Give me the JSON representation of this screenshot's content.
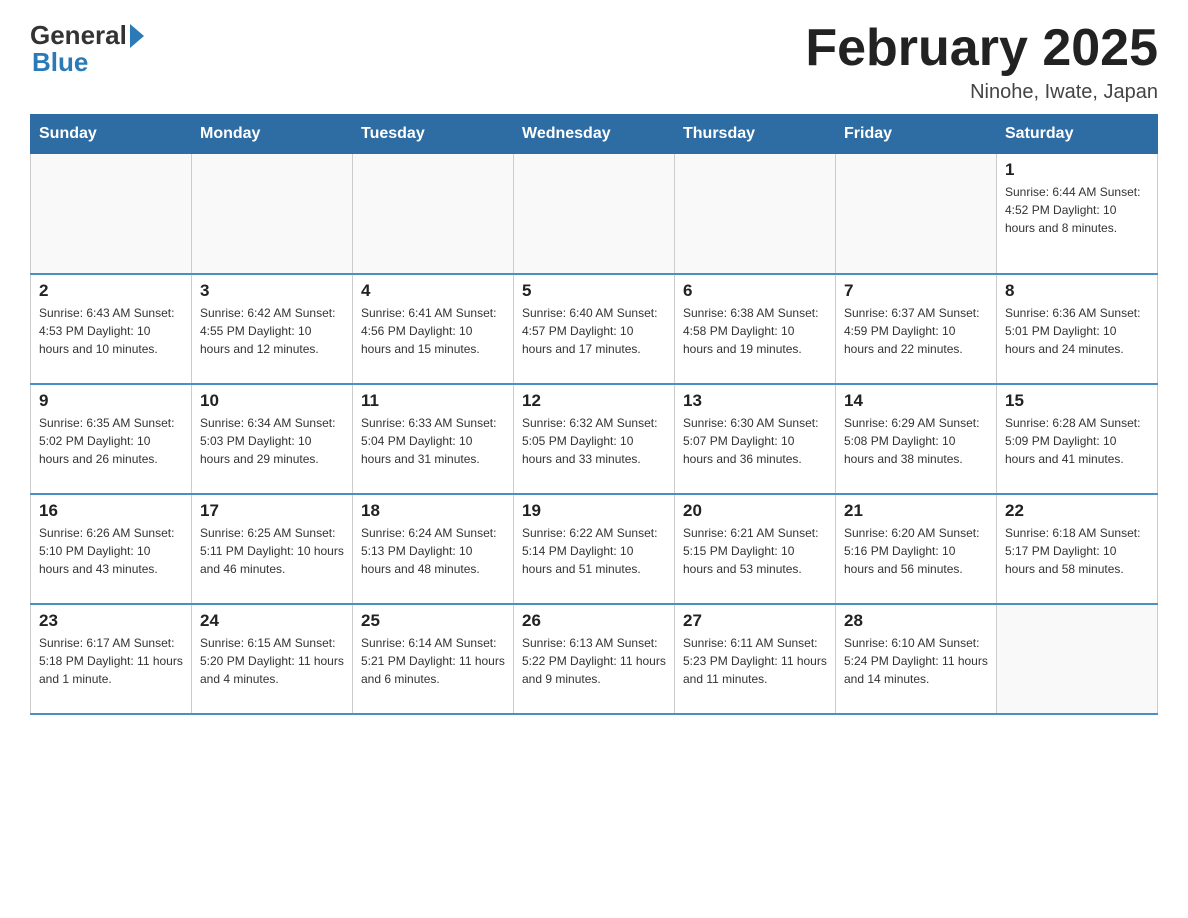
{
  "header": {
    "logo_general": "General",
    "logo_blue": "Blue",
    "month_title": "February 2025",
    "location": "Ninohe, Iwate, Japan"
  },
  "weekdays": [
    "Sunday",
    "Monday",
    "Tuesday",
    "Wednesday",
    "Thursday",
    "Friday",
    "Saturday"
  ],
  "weeks": [
    [
      {
        "day": "",
        "info": ""
      },
      {
        "day": "",
        "info": ""
      },
      {
        "day": "",
        "info": ""
      },
      {
        "day": "",
        "info": ""
      },
      {
        "day": "",
        "info": ""
      },
      {
        "day": "",
        "info": ""
      },
      {
        "day": "1",
        "info": "Sunrise: 6:44 AM\nSunset: 4:52 PM\nDaylight: 10 hours\nand 8 minutes."
      }
    ],
    [
      {
        "day": "2",
        "info": "Sunrise: 6:43 AM\nSunset: 4:53 PM\nDaylight: 10 hours\nand 10 minutes."
      },
      {
        "day": "3",
        "info": "Sunrise: 6:42 AM\nSunset: 4:55 PM\nDaylight: 10 hours\nand 12 minutes."
      },
      {
        "day": "4",
        "info": "Sunrise: 6:41 AM\nSunset: 4:56 PM\nDaylight: 10 hours\nand 15 minutes."
      },
      {
        "day": "5",
        "info": "Sunrise: 6:40 AM\nSunset: 4:57 PM\nDaylight: 10 hours\nand 17 minutes."
      },
      {
        "day": "6",
        "info": "Sunrise: 6:38 AM\nSunset: 4:58 PM\nDaylight: 10 hours\nand 19 minutes."
      },
      {
        "day": "7",
        "info": "Sunrise: 6:37 AM\nSunset: 4:59 PM\nDaylight: 10 hours\nand 22 minutes."
      },
      {
        "day": "8",
        "info": "Sunrise: 6:36 AM\nSunset: 5:01 PM\nDaylight: 10 hours\nand 24 minutes."
      }
    ],
    [
      {
        "day": "9",
        "info": "Sunrise: 6:35 AM\nSunset: 5:02 PM\nDaylight: 10 hours\nand 26 minutes."
      },
      {
        "day": "10",
        "info": "Sunrise: 6:34 AM\nSunset: 5:03 PM\nDaylight: 10 hours\nand 29 minutes."
      },
      {
        "day": "11",
        "info": "Sunrise: 6:33 AM\nSunset: 5:04 PM\nDaylight: 10 hours\nand 31 minutes."
      },
      {
        "day": "12",
        "info": "Sunrise: 6:32 AM\nSunset: 5:05 PM\nDaylight: 10 hours\nand 33 minutes."
      },
      {
        "day": "13",
        "info": "Sunrise: 6:30 AM\nSunset: 5:07 PM\nDaylight: 10 hours\nand 36 minutes."
      },
      {
        "day": "14",
        "info": "Sunrise: 6:29 AM\nSunset: 5:08 PM\nDaylight: 10 hours\nand 38 minutes."
      },
      {
        "day": "15",
        "info": "Sunrise: 6:28 AM\nSunset: 5:09 PM\nDaylight: 10 hours\nand 41 minutes."
      }
    ],
    [
      {
        "day": "16",
        "info": "Sunrise: 6:26 AM\nSunset: 5:10 PM\nDaylight: 10 hours\nand 43 minutes."
      },
      {
        "day": "17",
        "info": "Sunrise: 6:25 AM\nSunset: 5:11 PM\nDaylight: 10 hours\nand 46 minutes."
      },
      {
        "day": "18",
        "info": "Sunrise: 6:24 AM\nSunset: 5:13 PM\nDaylight: 10 hours\nand 48 minutes."
      },
      {
        "day": "19",
        "info": "Sunrise: 6:22 AM\nSunset: 5:14 PM\nDaylight: 10 hours\nand 51 minutes."
      },
      {
        "day": "20",
        "info": "Sunrise: 6:21 AM\nSunset: 5:15 PM\nDaylight: 10 hours\nand 53 minutes."
      },
      {
        "day": "21",
        "info": "Sunrise: 6:20 AM\nSunset: 5:16 PM\nDaylight: 10 hours\nand 56 minutes."
      },
      {
        "day": "22",
        "info": "Sunrise: 6:18 AM\nSunset: 5:17 PM\nDaylight: 10 hours\nand 58 minutes."
      }
    ],
    [
      {
        "day": "23",
        "info": "Sunrise: 6:17 AM\nSunset: 5:18 PM\nDaylight: 11 hours\nand 1 minute."
      },
      {
        "day": "24",
        "info": "Sunrise: 6:15 AM\nSunset: 5:20 PM\nDaylight: 11 hours\nand 4 minutes."
      },
      {
        "day": "25",
        "info": "Sunrise: 6:14 AM\nSunset: 5:21 PM\nDaylight: 11 hours\nand 6 minutes."
      },
      {
        "day": "26",
        "info": "Sunrise: 6:13 AM\nSunset: 5:22 PM\nDaylight: 11 hours\nand 9 minutes."
      },
      {
        "day": "27",
        "info": "Sunrise: 6:11 AM\nSunset: 5:23 PM\nDaylight: 11 hours\nand 11 minutes."
      },
      {
        "day": "28",
        "info": "Sunrise: 6:10 AM\nSunset: 5:24 PM\nDaylight: 11 hours\nand 14 minutes."
      },
      {
        "day": "",
        "info": ""
      }
    ]
  ]
}
